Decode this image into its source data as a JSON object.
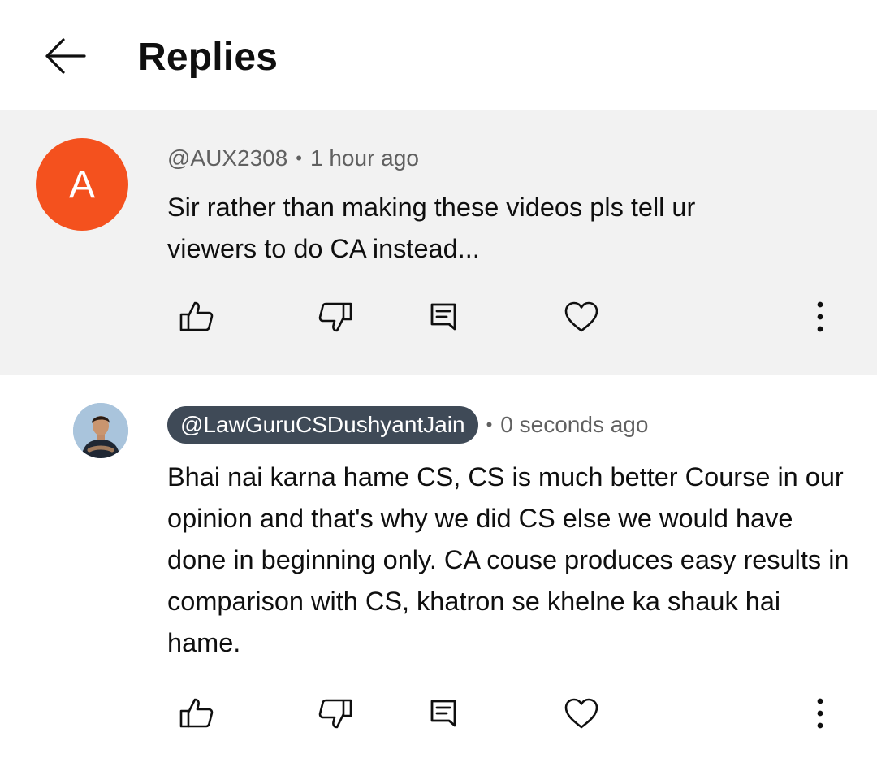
{
  "header": {
    "title": "Replies",
    "back_icon": "arrow-left-icon"
  },
  "parent_comment": {
    "avatar_letter": "A",
    "avatar_color": "#f4511e",
    "author": "@AUX2308",
    "separator": "•",
    "time": "1 hour ago",
    "text": "Sir rather than making these videos pls tell ur viewers to do CA instead..."
  },
  "reply_comment": {
    "author": "@LawGuruCSDushyantJain",
    "author_pill_color": "#3f4a57",
    "separator": "•",
    "time": "0 seconds ago",
    "text": "Bhai nai karna hame CS, CS is much better Course in our opinion and that's why we did CS else we would have done in beginning only. CA couse produces easy results in comparison with CS, khatron se khelne ka shauk hai hame."
  },
  "actions": [
    "thumbs-up-icon",
    "thumbs-down-icon",
    "reply-comment-icon",
    "heart-icon",
    "more-vertical-icon"
  ],
  "colors": {
    "parent_background": "#f2f2f2",
    "meta_text": "#606060"
  }
}
